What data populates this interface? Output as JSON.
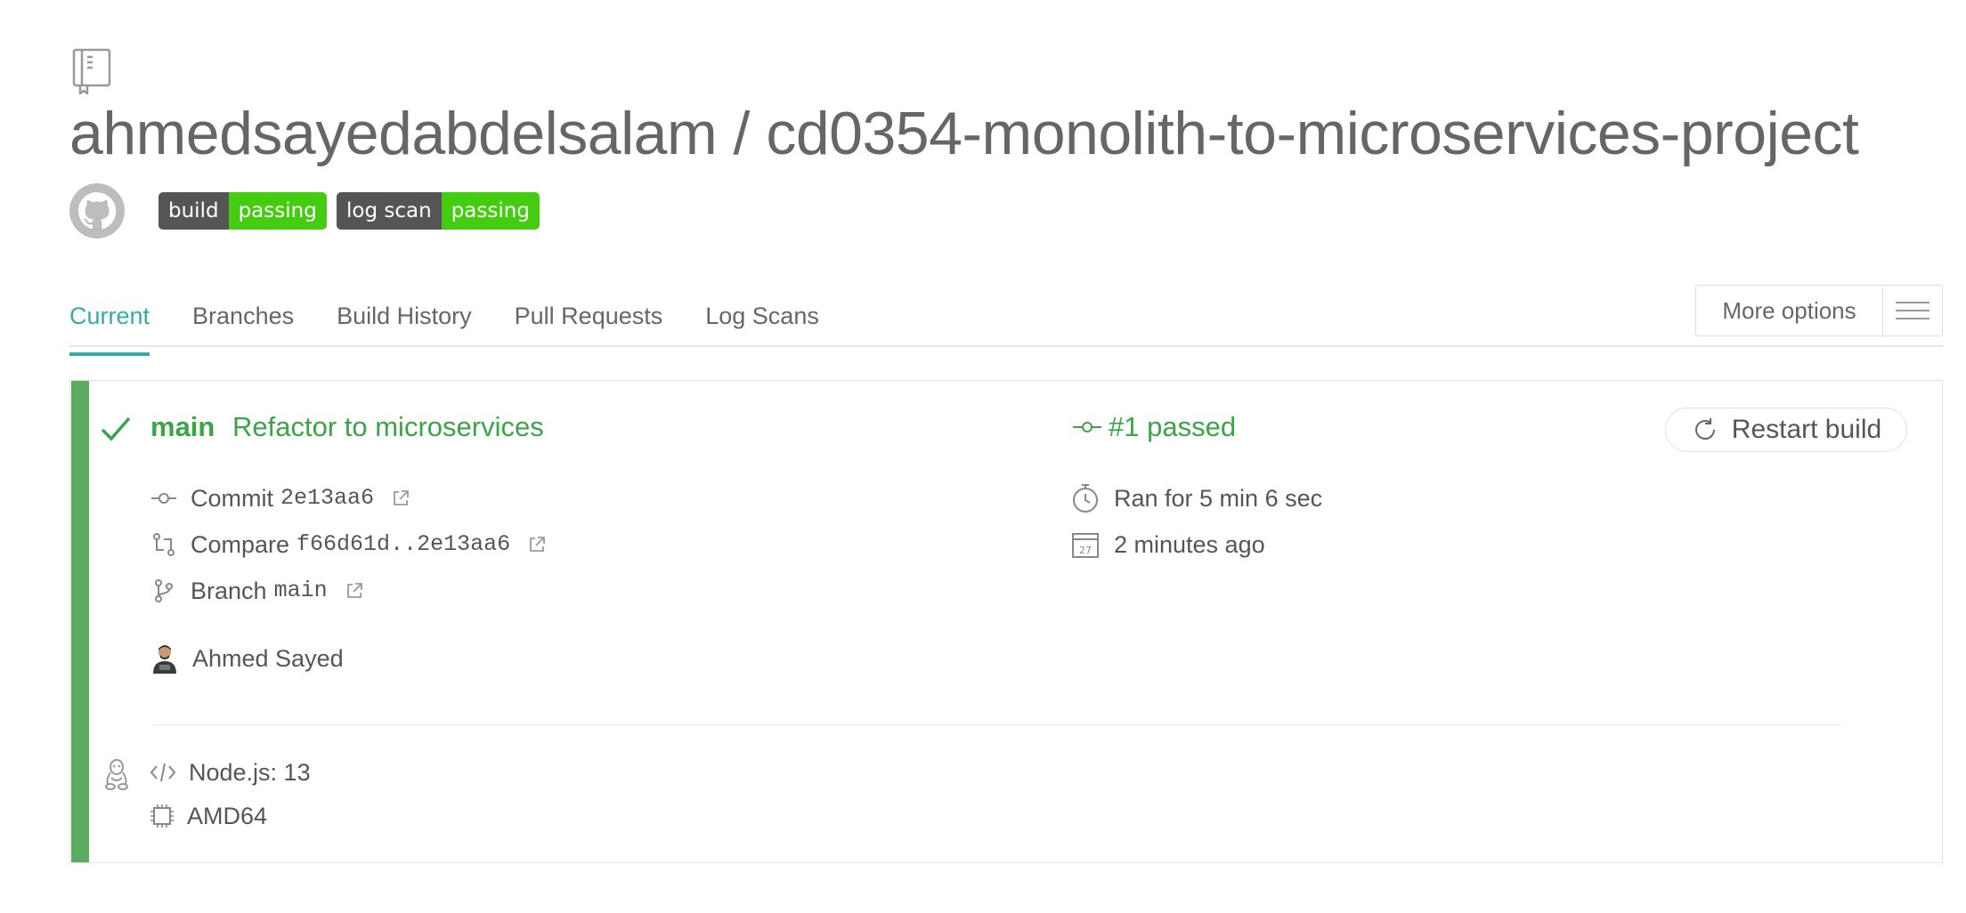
{
  "repo": {
    "title": "ahmedsayedabdelsalam / cd0354-monolith-to-microservices-project"
  },
  "badges": [
    {
      "label": "build",
      "status": "passing"
    },
    {
      "label": "log scan",
      "status": "passing"
    }
  ],
  "tabs": [
    {
      "label": "Current",
      "active": true
    },
    {
      "label": "Branches",
      "active": false
    },
    {
      "label": "Build History",
      "active": false
    },
    {
      "label": "Pull Requests",
      "active": false
    },
    {
      "label": "Log Scans",
      "active": false
    }
  ],
  "more_options": {
    "label": "More options"
  },
  "build": {
    "branch": "main",
    "message": "Refactor to microservices",
    "number_status": "#1 passed",
    "restart_label": "Restart build",
    "commit_label": "Commit",
    "commit_sha": "2e13aa6",
    "compare_label": "Compare",
    "compare_range": "f66d61d..2e13aa6",
    "branch_label": "Branch",
    "branch_value": "main",
    "duration": "Ran for 5 min 6 sec",
    "finished": "2 minutes ago",
    "calendar_day": "27",
    "author": "Ahmed Sayed",
    "language": "Node.js: 13",
    "arch": "AMD64"
  },
  "colors": {
    "passed_green": "#39a547",
    "stripe_green": "#5aaa5f",
    "tab_active": "#39aaa4",
    "badge_dark": "#555555",
    "badge_green": "#44cc11"
  }
}
